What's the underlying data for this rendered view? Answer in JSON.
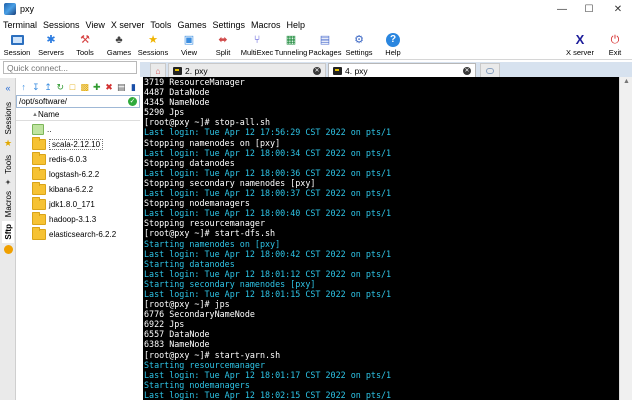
{
  "window": {
    "title": "pxy"
  },
  "menu": [
    "Terminal",
    "Sessions",
    "View",
    "X server",
    "Tools",
    "Games",
    "Settings",
    "Macros",
    "Help"
  ],
  "toolbar": [
    {
      "label": "Session",
      "icon": "monitor-icon",
      "color": "#2c6fbf"
    },
    {
      "label": "Servers",
      "icon": "servers-icon",
      "color": "#2a7be0"
    },
    {
      "label": "Tools",
      "icon": "tools-icon",
      "color": "#d64040"
    },
    {
      "label": "Games",
      "icon": "games-icon",
      "color": "#444"
    },
    {
      "label": "Sessions",
      "icon": "star-icon",
      "color": "#f0b400"
    },
    {
      "label": "View",
      "icon": "view-icon",
      "color": "#3a8de0"
    },
    {
      "label": "Split",
      "icon": "split-icon",
      "color": "#d04a4a"
    },
    {
      "label": "MultiExec",
      "icon": "multiexec-icon",
      "color": "#4b4bd6"
    },
    {
      "label": "Tunneling",
      "icon": "tunneling-icon",
      "color": "#1a8a3a"
    },
    {
      "label": "Packages",
      "icon": "packages-icon",
      "color": "#4c6ecf"
    },
    {
      "label": "Settings",
      "icon": "settings-icon",
      "color": "#3a66c4"
    },
    {
      "label": "Help",
      "icon": "help-icon",
      "color": "#2a86df"
    },
    {
      "label": "X server",
      "icon": "xserver-icon",
      "color": "#1c1c9a"
    },
    {
      "label": "Exit",
      "icon": "power-icon",
      "color": "#d42323"
    }
  ],
  "quick_connect": {
    "placeholder": "Quick connect..."
  },
  "side_tabs": [
    "Sessions",
    "Tools",
    "Macros",
    "Sftp"
  ],
  "sftp": {
    "path": "/opt/software/",
    "column_name": "Name",
    "files": [
      {
        "name": "..",
        "type": "parent"
      },
      {
        "name": "scala-2.12.10",
        "type": "folder"
      },
      {
        "name": "redis-6.0.3",
        "type": "folder"
      },
      {
        "name": "logstash-6.2.2",
        "type": "folder"
      },
      {
        "name": "kibana-6.2.2",
        "type": "folder"
      },
      {
        "name": "jdk1.8.0_171",
        "type": "folder"
      },
      {
        "name": "hadoop-3.1.3",
        "type": "folder"
      },
      {
        "name": "elasticsearch-6.2.2",
        "type": "folder"
      }
    ]
  },
  "tabs": [
    {
      "label": "2. pxy",
      "active": false
    },
    {
      "label": "4. pxy",
      "active": true
    }
  ],
  "terminal": {
    "lines": [
      {
        "text": "3719 ResourceManager",
        "kind": "normal"
      },
      {
        "text": "4487 DataNode",
        "kind": "normal"
      },
      {
        "text": "4345 NameNode",
        "kind": "normal"
      },
      {
        "text": "5290 Jps",
        "kind": "normal"
      },
      {
        "text": "[root@pxy ~]# stop-all.sh",
        "kind": "normal"
      },
      {
        "text": "Last login: Tue Apr 12 17:56:29 CST 2022 on pts/1",
        "kind": "login"
      },
      {
        "text": "Stopping namenodes on [pxy]",
        "kind": "normal"
      },
      {
        "text": "Last login: Tue Apr 12 18:00:34 CST 2022 on pts/1",
        "kind": "login"
      },
      {
        "text": "Stopping datanodes",
        "kind": "normal"
      },
      {
        "text": "Last login: Tue Apr 12 18:00:36 CST 2022 on pts/1",
        "kind": "login"
      },
      {
        "text": "Stopping secondary namenodes [pxy]",
        "kind": "normal"
      },
      {
        "text": "Last login: Tue Apr 12 18:00:37 CST 2022 on pts/1",
        "kind": "login"
      },
      {
        "text": "Stopping nodemanagers",
        "kind": "normal"
      },
      {
        "text": "Last login: Tue Apr 12 18:00:40 CST 2022 on pts/1",
        "kind": "login"
      },
      {
        "text": "Stopping resourcemanager",
        "kind": "normal"
      },
      {
        "text": "[root@pxy ~]# start-dfs.sh",
        "kind": "normal"
      },
      {
        "text": "Starting namenodes on [pxy]",
        "kind": "status"
      },
      {
        "text": "Last login: Tue Apr 12 18:00:42 CST 2022 on pts/1",
        "kind": "login"
      },
      {
        "text": "Starting datanodes",
        "kind": "status"
      },
      {
        "text": "Last login: Tue Apr 12 18:01:12 CST 2022 on pts/1",
        "kind": "login"
      },
      {
        "text": "Starting secondary namenodes [pxy]",
        "kind": "status"
      },
      {
        "text": "Last login: Tue Apr 12 18:01:15 CST 2022 on pts/1",
        "kind": "login"
      },
      {
        "text": "[root@pxy ~]# jps",
        "kind": "normal"
      },
      {
        "text": "6776 SecondaryNameNode",
        "kind": "normal"
      },
      {
        "text": "6922 Jps",
        "kind": "normal"
      },
      {
        "text": "6557 DataNode",
        "kind": "normal"
      },
      {
        "text": "6383 NameNode",
        "kind": "normal"
      },
      {
        "text": "[root@pxy ~]# start-yarn.sh",
        "kind": "normal"
      },
      {
        "text": "Starting resourcemanager",
        "kind": "status"
      },
      {
        "text": "Last login: Tue Apr 12 18:01:17 CST 2022 on pts/1",
        "kind": "login"
      },
      {
        "text": "Starting nodemanagers",
        "kind": "status"
      },
      {
        "text": "Last login: Tue Apr 12 18:02:15 CST 2022 on pts/1",
        "kind": "login"
      }
    ]
  }
}
